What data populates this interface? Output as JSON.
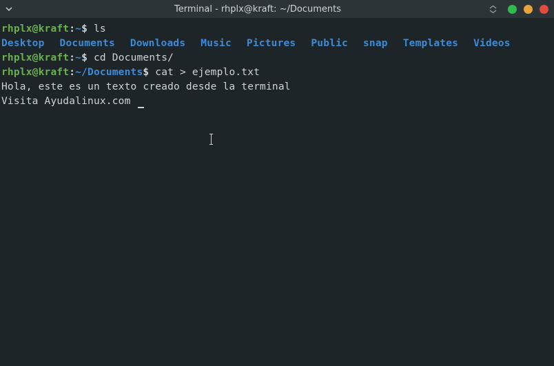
{
  "titlebar": {
    "title": "Terminal - rhplx@kraft: ~/Documents"
  },
  "prompt1": {
    "user": "rhplx@kraft",
    "colon": ":",
    "path": "~",
    "dollar": "$ ",
    "command": "ls"
  },
  "ls": {
    "items": [
      "Desktop",
      "Documents",
      "Downloads",
      "Music",
      "Pictures",
      "Public",
      "snap",
      "Templates",
      "Videos"
    ]
  },
  "prompt2": {
    "user": "rhplx@kraft",
    "colon": ":",
    "path": "~",
    "dollar": "$ ",
    "command": "cd Documents/"
  },
  "prompt3": {
    "user": "rhplx@kraft",
    "colon": ":",
    "path": "~/Documents",
    "dollar": "$ ",
    "command": "cat > ejemplo.txt"
  },
  "input1": "Hola, este es un texto creado desde la terminal",
  "input2": "Visita Ayudalinux.com "
}
